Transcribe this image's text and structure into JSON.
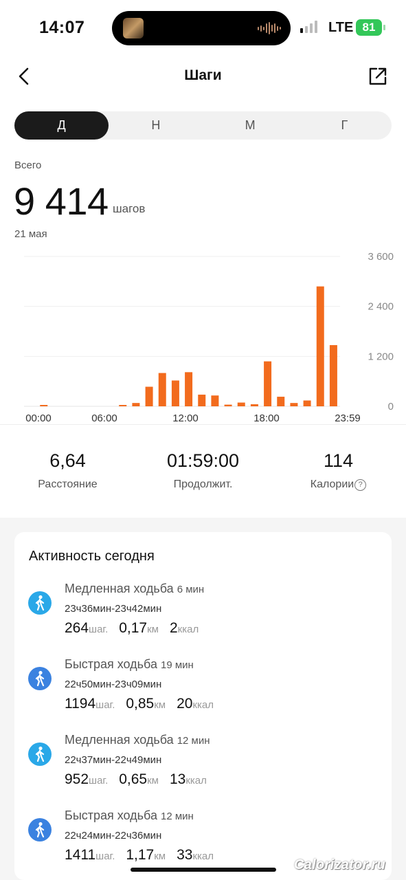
{
  "status_bar": {
    "time": "14:07",
    "network": "LTE",
    "battery": "81",
    "battery_color": "#33c759"
  },
  "header": {
    "title": "Шаги",
    "back_icon": "chevron-left-icon",
    "export_icon": "share-external-icon"
  },
  "period_tabs": [
    {
      "label": "Д",
      "active": true
    },
    {
      "label": "Н",
      "active": false
    },
    {
      "label": "М",
      "active": false
    },
    {
      "label": "Г",
      "active": false
    }
  ],
  "summary": {
    "total_label": "Всего",
    "total_value": "9 414",
    "total_unit": "шагов",
    "date": "21 мая"
  },
  "chart_data": {
    "type": "bar",
    "bar_color": "#f26b1d",
    "x_tick_labels": [
      "00:00",
      "06:00",
      "12:00",
      "18:00",
      "23:59"
    ],
    "y_tick_labels": [
      "3 600",
      "2 400",
      "1 200",
      "0"
    ],
    "ylim": [
      0,
      3600
    ],
    "grid": true,
    "categories": [
      "00:00",
      "01:00",
      "02:00",
      "03:00",
      "04:00",
      "05:00",
      "06:00",
      "07:00",
      "08:00",
      "09:00",
      "10:00",
      "11:00",
      "12:00",
      "13:00",
      "14:00",
      "15:00",
      "16:00",
      "17:00",
      "18:00",
      "19:00",
      "20:00",
      "21:00",
      "22:00",
      "23:00"
    ],
    "values": [
      0,
      20,
      0,
      0,
      0,
      0,
      0,
      30,
      80,
      470,
      800,
      620,
      820,
      280,
      260,
      40,
      90,
      50,
      1080,
      230,
      80,
      140,
      2880,
      1470
    ]
  },
  "stats": [
    {
      "value": "6,64",
      "label": "Расстояние",
      "help": false
    },
    {
      "value": "01:59:00",
      "label": "Продолжит.",
      "help": false
    },
    {
      "value": "114",
      "label": "Калории",
      "help": true
    }
  ],
  "activity": {
    "title": "Активность сегодня",
    "items": [
      {
        "name": "Медленная ходьба",
        "duration": "6 мин",
        "range": "23ч36мин-23ч42мин",
        "steps": "264",
        "steps_unit": "шаг.",
        "distance": "0,17",
        "distance_unit": "км",
        "calories": "2",
        "calories_unit": "ккал",
        "icon": "walking-icon",
        "kind": "slow"
      },
      {
        "name": "Быстрая ходьба",
        "duration": "19 мин",
        "range": "22ч50мин-23ч09мин",
        "steps": "1194",
        "steps_unit": "шаг.",
        "distance": "0,85",
        "distance_unit": "км",
        "calories": "20",
        "calories_unit": "ккал",
        "icon": "fast-walking-icon",
        "kind": "fast"
      },
      {
        "name": "Медленная ходьба",
        "duration": "12 мин",
        "range": "22ч37мин-22ч49мин",
        "steps": "952",
        "steps_unit": "шаг.",
        "distance": "0,65",
        "distance_unit": "км",
        "calories": "13",
        "calories_unit": "ккал",
        "icon": "walking-icon",
        "kind": "slow"
      },
      {
        "name": "Быстрая ходьба",
        "duration": "12 мин",
        "range": "22ч24мин-22ч36мин",
        "steps": "1411",
        "steps_unit": "шаг.",
        "distance": "1,17",
        "distance_unit": "км",
        "calories": "33",
        "calories_unit": "ккал",
        "icon": "fast-walking-icon",
        "kind": "fast"
      }
    ]
  },
  "watermark": "Calorizator.ru"
}
